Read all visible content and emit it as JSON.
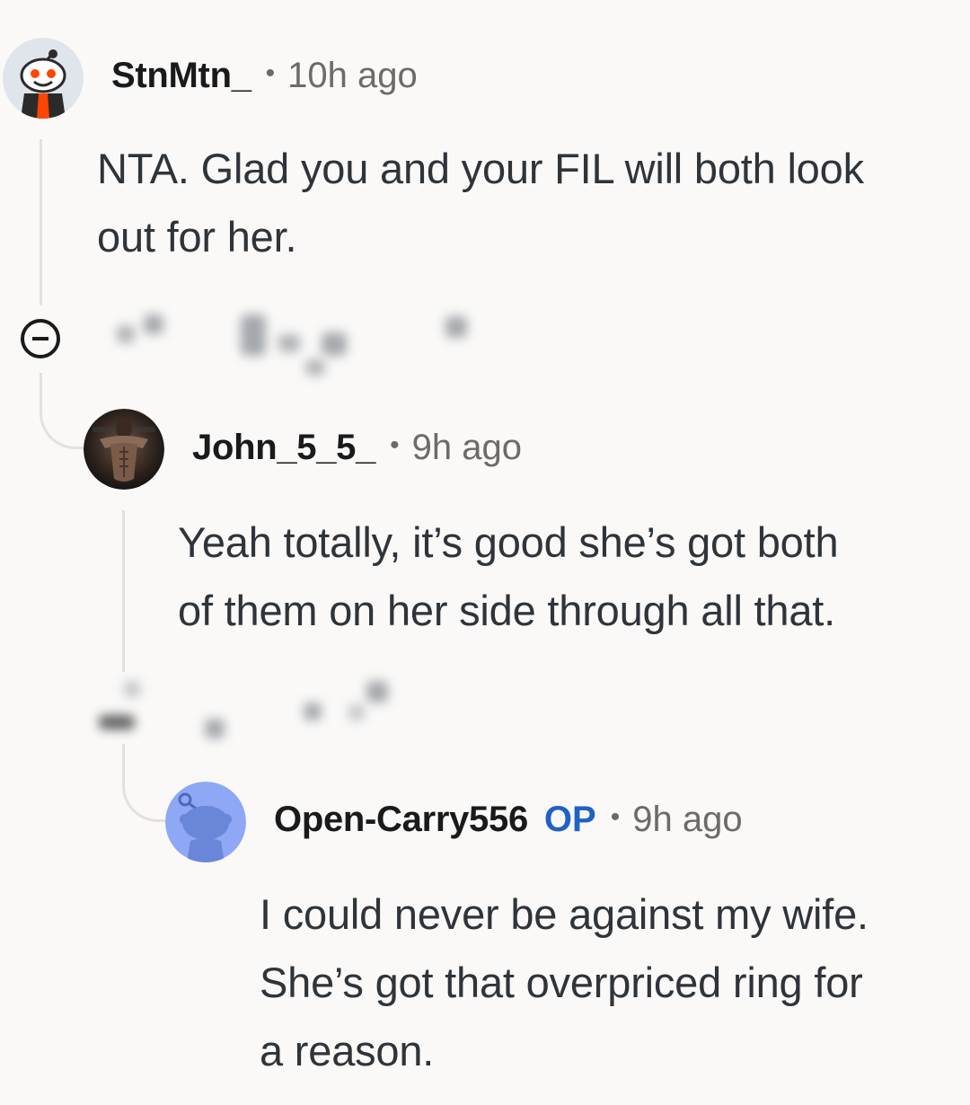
{
  "comments": [
    {
      "username": "StnMtn_",
      "time": "10h ago",
      "body_line1": "NTA. Glad you and your FIL will both look",
      "body_line2": "out for her.",
      "avatar_icon": "snoo-avatar-orange-icon"
    },
    {
      "username": "John_5_5_",
      "time": "9h ago",
      "body_line1": "Yeah totally, it’s good she’s got both",
      "body_line2": "of them on her side through all that.",
      "avatar_icon": "photo-avatar-icon"
    },
    {
      "username": "Open-Carry556",
      "badge": "OP",
      "time": "9h ago",
      "body_line1": "I could never be against my wife.",
      "body_line2": "She’s got that overpriced ring for",
      "body_line3": "a reason.",
      "avatar_icon": "snoo-avatar-blue-icon"
    }
  ],
  "separator": "•",
  "icons": {
    "collapse": "collapse-thread-icon",
    "actions": "blurred-action-icons"
  },
  "colors": {
    "background": "#faf9f8",
    "op_badge": "#1f62c5",
    "thread_line": "#e3e1df"
  }
}
